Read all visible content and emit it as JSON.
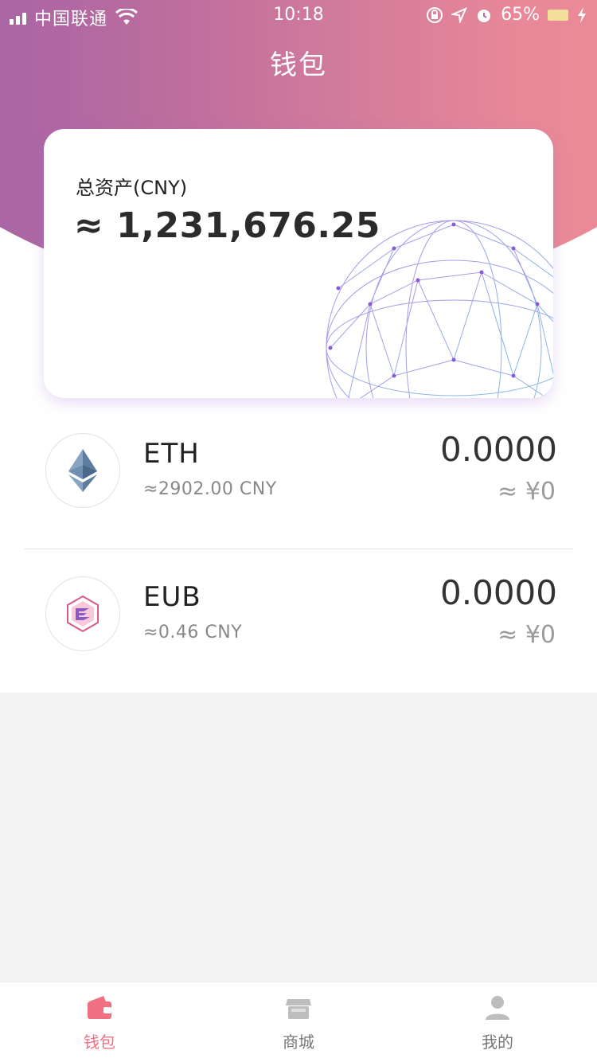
{
  "status_bar": {
    "carrier": "中国联通",
    "time": "10:18",
    "battery_percent": "65%"
  },
  "header": {
    "title": "钱包"
  },
  "asset_card": {
    "label": "总资产(CNY)",
    "value": "≈ 1,231,676.25"
  },
  "tokens": [
    {
      "name": "ETH",
      "price": "≈2902.00 CNY",
      "amount": "0.0000",
      "fiat": "≈ ¥0",
      "icon": "ethereum-icon"
    },
    {
      "name": "EUB",
      "price": "≈0.46 CNY",
      "amount": "0.0000",
      "fiat": "≈ ¥0",
      "icon": "eub-icon"
    }
  ],
  "tab_bar": {
    "tabs": [
      {
        "label": "钱包",
        "icon": "wallet-icon",
        "active": true
      },
      {
        "label": "商城",
        "icon": "shop-icon",
        "active": false
      },
      {
        "label": "我的",
        "icon": "profile-icon",
        "active": false
      }
    ]
  },
  "colors": {
    "gradient_start": "#8e5ab0",
    "gradient_end": "#f49092",
    "accent": "#f07082"
  }
}
